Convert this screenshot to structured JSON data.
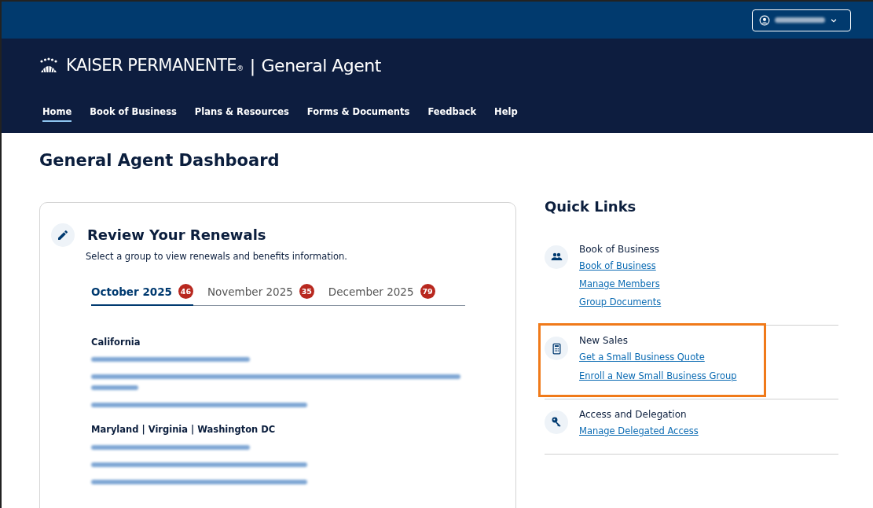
{
  "top_bar": {
    "user_menu": {
      "name_redacted": true
    }
  },
  "header": {
    "brand": "KAISER PERMANENTE",
    "brand_mark": "®",
    "separator": "|",
    "app_name": "General Agent"
  },
  "nav": [
    {
      "label": "Home",
      "selected": true
    },
    {
      "label": "Book of Business",
      "selected": false
    },
    {
      "label": "Plans & Resources",
      "selected": false
    },
    {
      "label": "Forms & Documents",
      "selected": false
    },
    {
      "label": "Feedback",
      "selected": false
    },
    {
      "label": "Help",
      "selected": false
    }
  ],
  "page_title": "General Agent Dashboard",
  "renewals": {
    "title": "Review Your Renewals",
    "subtitle": "Select a group to view renewals and benefits information.",
    "tabs": [
      {
        "label": "October 2025",
        "count": "46",
        "selected": true
      },
      {
        "label": "November 2025",
        "count": "35",
        "selected": false
      },
      {
        "label": "December 2025",
        "count": "79",
        "selected": false
      }
    ],
    "groups": [
      {
        "region": "California",
        "links": [
          {
            "kind": "short"
          },
          {
            "kind": "wrapped"
          },
          {
            "kind": "medium"
          }
        ]
      },
      {
        "region": "Maryland | Virginia | Washington DC",
        "links": [
          {
            "kind": "short"
          },
          {
            "kind": "medium"
          },
          {
            "kind": "medium"
          }
        ]
      }
    ]
  },
  "quick_links": {
    "title": "Quick Links",
    "sections": [
      {
        "kind": "people",
        "heading": "Book of Business",
        "highlighted": false,
        "links": [
          "Book of Business",
          "Manage Members",
          "Group Documents"
        ]
      },
      {
        "kind": "calculator",
        "heading": "New Sales",
        "highlighted": true,
        "links": [
          "Get a Small Business Quote",
          "Enroll a New Small Business Group"
        ]
      },
      {
        "kind": "key",
        "heading": "Access and Delegation",
        "highlighted": false,
        "links": [
          "Manage Delegated Access"
        ]
      }
    ]
  }
}
